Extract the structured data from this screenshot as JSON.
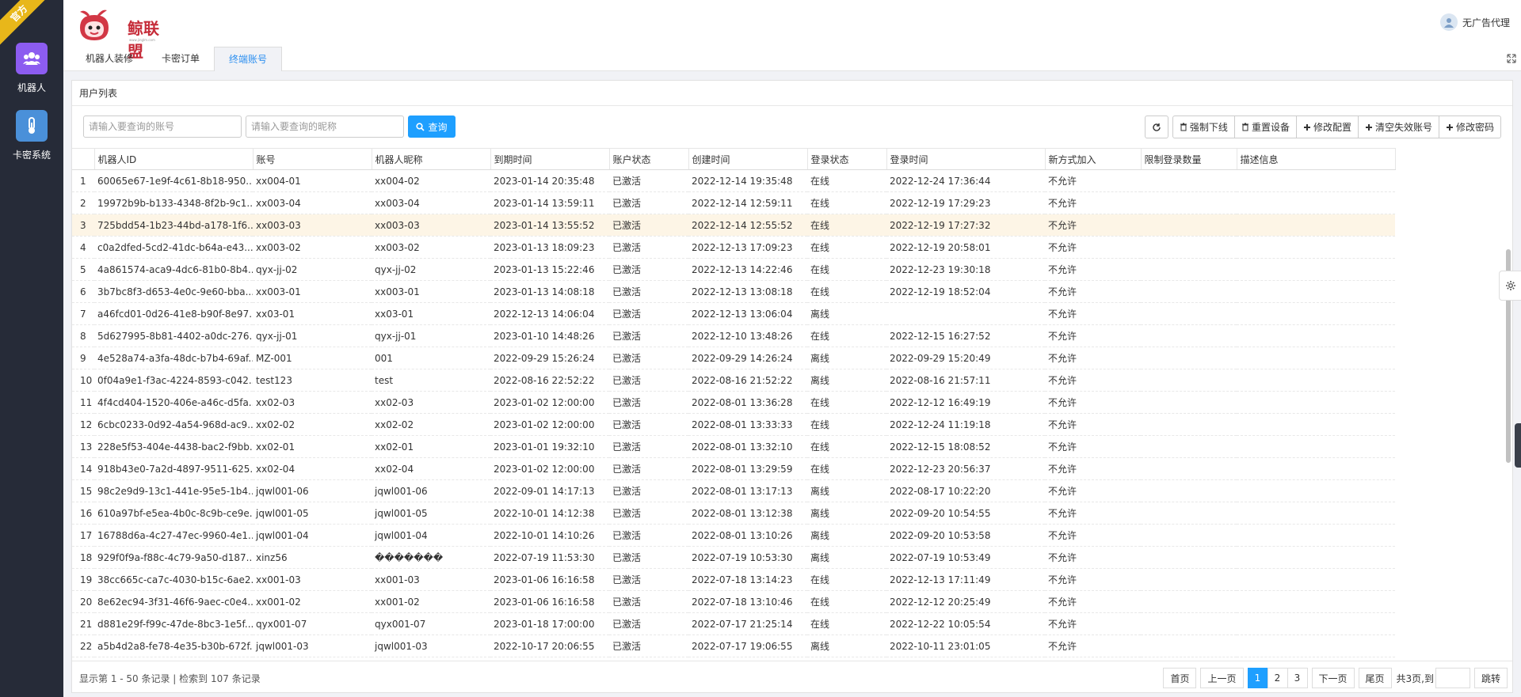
{
  "ribbon": "官方",
  "sidebar": {
    "items": [
      {
        "label": "机器人"
      },
      {
        "label": "卡密系统"
      }
    ]
  },
  "header": {
    "logo_text": "鲸联盟",
    "logo_sub": "www.jinglm.com",
    "user_name": "无广告代理"
  },
  "tabs": [
    {
      "label": "机器人装修"
    },
    {
      "label": "卡密订单"
    },
    {
      "label": "终端账号"
    }
  ],
  "panel": {
    "title": "用户列表"
  },
  "search": {
    "account_placeholder": "请输入要查询的账号",
    "nickname_placeholder": "请输入要查询的昵称",
    "query_label": "查询"
  },
  "toolbar": {
    "force_offline": "强制下线",
    "reset_device": "重置设备",
    "edit_config": "修改配置",
    "clear_invalid": "清空失效账号",
    "change_password": "修改密码"
  },
  "table": {
    "columns": [
      "机器人ID",
      "账号",
      "机器人昵称",
      "到期时间",
      "账户状态",
      "创建时间",
      "登录状态",
      "登录时间",
      "新方式加入",
      "限制登录数量",
      "描述信息"
    ],
    "rows": [
      [
        "1",
        "60065e67-1e9f-4c61-8b18-950...",
        "xx004-01",
        "xx004-02",
        "2023-01-14 20:35:48",
        "已激活",
        "2022-12-14 19:35:48",
        "在线",
        "2022-12-24 17:36:44",
        "不允许",
        "",
        ""
      ],
      [
        "2",
        "19972b9b-b133-4348-8f2b-9c1...",
        "xx003-04",
        "xx003-04",
        "2023-01-14 13:59:11",
        "已激活",
        "2022-12-14 12:59:11",
        "在线",
        "2022-12-19 17:29:23",
        "不允许",
        "",
        ""
      ],
      [
        "3",
        "725bdd54-1b23-44bd-a178-1f6...",
        "xx003-03",
        "xx003-03",
        "2023-01-14 13:55:52",
        "已激活",
        "2022-12-14 12:55:52",
        "在线",
        "2022-12-19 17:27:32",
        "不允许",
        "",
        ""
      ],
      [
        "4",
        "c0a2dfed-5cd2-41dc-b64a-e43...",
        "xx003-02",
        "xx003-02",
        "2023-01-13 18:09:23",
        "已激活",
        "2022-12-13 17:09:23",
        "在线",
        "2022-12-19 20:58:01",
        "不允许",
        "",
        ""
      ],
      [
        "5",
        "4a861574-aca9-4dc6-81b0-8b4...",
        "qyx-jj-02",
        "qyx-jj-02",
        "2023-01-13 15:22:46",
        "已激活",
        "2022-12-13 14:22:46",
        "在线",
        "2022-12-23 19:30:18",
        "不允许",
        "",
        ""
      ],
      [
        "6",
        "3b7bc8f3-d653-4e0c-9e60-bba...",
        "xx003-01",
        "xx003-01",
        "2023-01-13 14:08:18",
        "已激活",
        "2022-12-13 13:08:18",
        "在线",
        "2022-12-19 18:52:04",
        "不允许",
        "",
        ""
      ],
      [
        "7",
        "a46fcd01-0d26-41e8-b90f-8e97...",
        "xx03-01",
        "xx03-01",
        "2022-12-13 14:06:04",
        "已激活",
        "2022-12-13 13:06:04",
        "离线",
        "",
        "不允许",
        "",
        ""
      ],
      [
        "8",
        "5d627995-8b81-4402-a0dc-276...",
        "qyx-jj-01",
        "qyx-jj-01",
        "2023-01-10 14:48:26",
        "已激活",
        "2022-12-10 13:48:26",
        "在线",
        "2022-12-15 16:27:52",
        "不允许",
        "",
        ""
      ],
      [
        "9",
        "4e528a74-a3fa-48dc-b7b4-69af...",
        "MZ-001",
        "001",
        "2022-09-29 15:26:24",
        "已激活",
        "2022-09-29 14:26:24",
        "离线",
        "2022-09-29 15:20:49",
        "不允许",
        "",
        ""
      ],
      [
        "10",
        "0f04a9e1-f3ac-4224-8593-c042...",
        "test123",
        "test",
        "2022-08-16 22:52:22",
        "已激活",
        "2022-08-16 21:52:22",
        "离线",
        "2022-08-16 21:57:11",
        "不允许",
        "",
        ""
      ],
      [
        "11",
        "4f4cd404-1520-406e-a46c-d5fa...",
        "xx02-03",
        "xx02-03",
        "2023-01-02 12:00:00",
        "已激活",
        "2022-08-01 13:36:28",
        "在线",
        "2022-12-12 16:49:19",
        "不允许",
        "",
        ""
      ],
      [
        "12",
        "6cbc0233-0d92-4a54-968d-ac9...",
        "xx02-02",
        "xx02-02",
        "2023-01-02 12:00:00",
        "已激活",
        "2022-08-01 13:33:33",
        "在线",
        "2022-12-24 11:19:18",
        "不允许",
        "",
        ""
      ],
      [
        "13",
        "228e5f53-404e-4438-bac2-f9bb...",
        "xx02-01",
        "xx02-01",
        "2023-01-01 19:32:10",
        "已激活",
        "2022-08-01 13:32:10",
        "在线",
        "2022-12-15 18:08:52",
        "不允许",
        "",
        ""
      ],
      [
        "14",
        "918b43e0-7a2d-4897-9511-625...",
        "xx02-04",
        "xx02-04",
        "2023-01-02 12:00:00",
        "已激活",
        "2022-08-01 13:29:59",
        "在线",
        "2022-12-23 20:56:37",
        "不允许",
        "",
        ""
      ],
      [
        "15",
        "98c2e9d9-13c1-441e-95e5-1b4...",
        "jqwl001-06",
        "jqwl001-06",
        "2022-09-01 14:17:13",
        "已激活",
        "2022-08-01 13:17:13",
        "离线",
        "2022-08-17 10:22:20",
        "不允许",
        "",
        ""
      ],
      [
        "16",
        "610a97bf-e5ea-4b0c-8c9b-ce9e...",
        "jqwl001-05",
        "jqwl001-05",
        "2022-10-01 14:12:38",
        "已激活",
        "2022-08-01 13:12:38",
        "离线",
        "2022-09-20 10:54:55",
        "不允许",
        "",
        ""
      ],
      [
        "17",
        "16788d6a-4c27-47ec-9960-4e1...",
        "jqwl001-04",
        "jqwl001-04",
        "2022-10-01 14:10:26",
        "已激活",
        "2022-08-01 13:10:26",
        "离线",
        "2022-09-20 10:53:58",
        "不允许",
        "",
        ""
      ],
      [
        "18",
        "929f0f9a-f88c-4c79-9a50-d187...",
        "xinz56",
        "�������",
        "2022-07-19 11:53:30",
        "已激活",
        "2022-07-19 10:53:30",
        "离线",
        "2022-07-19 10:53:49",
        "不允许",
        "",
        ""
      ],
      [
        "19",
        "38cc665c-ca7c-4030-b15c-6ae2...",
        "xx001-03",
        "xx001-03",
        "2023-01-06 16:16:58",
        "已激活",
        "2022-07-18 13:14:23",
        "在线",
        "2022-12-13 17:11:49",
        "不允许",
        "",
        ""
      ],
      [
        "20",
        "8e62ec94-3f31-46f6-9aec-c0e4...",
        "xx001-02",
        "xx001-02",
        "2023-01-06 16:16:58",
        "已激活",
        "2022-07-18 13:10:46",
        "在线",
        "2022-12-12 20:25:49",
        "不允许",
        "",
        ""
      ],
      [
        "21",
        "d881e29f-f99c-47de-8bc3-1e5f...",
        "qyx001-07",
        "qyx001-07",
        "2023-01-18 17:00:00",
        "已激活",
        "2022-07-17 21:25:14",
        "在线",
        "2022-12-22 10:05:54",
        "不允许",
        "",
        ""
      ],
      [
        "22",
        "a5b4d2a8-fe78-4e35-b30b-672f...",
        "jqwl001-03",
        "jqwl001-03",
        "2022-10-17 20:06:55",
        "已激活",
        "2022-07-17 19:06:55",
        "离线",
        "2022-10-11 23:01:05",
        "不允许",
        "",
        ""
      ]
    ]
  },
  "footer": {
    "info": "显示第 1 - 50 条记录 | 检索到 107 条记录"
  },
  "pager": {
    "first": "首页",
    "prev": "上一页",
    "pages": [
      "1",
      "2",
      "3"
    ],
    "next": "下一页",
    "last": "尾页",
    "total": "共3页,到",
    "jump": "跳转"
  },
  "colors": {
    "sidebar_bg": "#262b38",
    "accent": "#1e9fff",
    "ribbon": "#e8b71a",
    "highlight_row": "#fdf5e6"
  }
}
